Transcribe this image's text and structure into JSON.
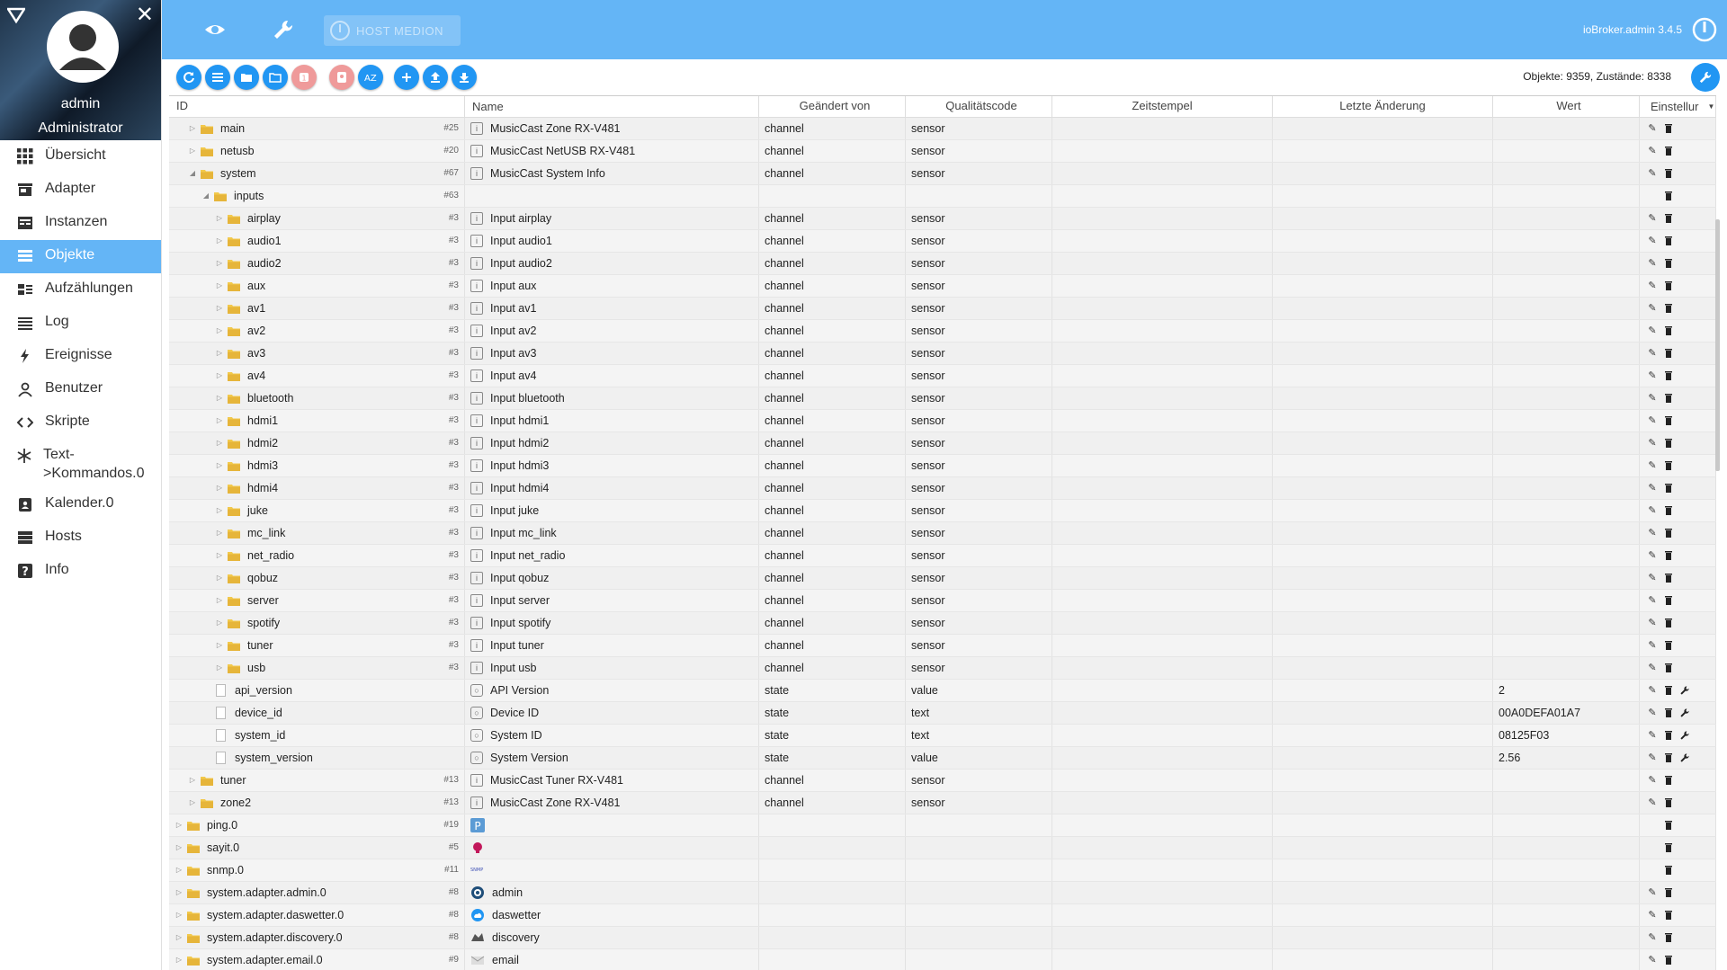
{
  "sidebar": {
    "user": "admin",
    "role": "Administrator",
    "items": [
      {
        "label": "Übersicht",
        "icon": "grid-icon"
      },
      {
        "label": "Adapter",
        "icon": "store-icon"
      },
      {
        "label": "Instanzen",
        "icon": "instances-icon"
      },
      {
        "label": "Objekte",
        "icon": "list-icon",
        "active": true
      },
      {
        "label": "Aufzählungen",
        "icon": "enum-icon"
      },
      {
        "label": "Log",
        "icon": "log-icon"
      },
      {
        "label": "Ereignisse",
        "icon": "bolt-icon"
      },
      {
        "label": "Benutzer",
        "icon": "user-icon"
      },
      {
        "label": "Skripte",
        "icon": "code-icon"
      },
      {
        "label": "Text->Kommandos.0",
        "icon": "snowflake-icon"
      },
      {
        "label": "Kalender.0",
        "icon": "calendar-icon"
      },
      {
        "label": "Hosts",
        "icon": "hosts-icon"
      },
      {
        "label": "Info",
        "icon": "help-icon"
      }
    ]
  },
  "topbar": {
    "host_label": "HOST MEDION",
    "version": "ioBroker.admin 3.4.5"
  },
  "toolbar": {
    "counts": "Objekte: 9359, Zustände: 8338"
  },
  "table": {
    "headers": {
      "id": "ID",
      "name": "Name",
      "changed_by": "Geändert von",
      "quality": "Qualitätscode",
      "timestamp": "Zeitstempel",
      "last_change": "Letzte Änderung",
      "value": "Wert",
      "settings": "Einstellur"
    },
    "rows": [
      {
        "id": "main",
        "indent": 1,
        "kind": "folder",
        "arrow": "▷",
        "count": "#25",
        "name": "MusicCast Zone RX-V481",
        "nicon": "i",
        "changed": "channel",
        "quality": "sensor",
        "value": "",
        "actions": "ed"
      },
      {
        "id": "netusb",
        "indent": 1,
        "kind": "folder",
        "arrow": "▷",
        "count": "#20",
        "name": "MusicCast NetUSB RX-V481",
        "nicon": "i",
        "changed": "channel",
        "quality": "sensor",
        "value": "",
        "actions": "ed"
      },
      {
        "id": "system",
        "indent": 1,
        "kind": "folder",
        "arrow": "◢",
        "count": "#67",
        "name": "MusicCast System Info",
        "nicon": "i",
        "changed": "channel",
        "quality": "sensor",
        "value": "",
        "actions": "ed"
      },
      {
        "id": "inputs",
        "indent": 2,
        "kind": "folder",
        "arrow": "◢",
        "count": "#63",
        "name": "",
        "nicon": "",
        "changed": "",
        "quality": "",
        "value": "",
        "actions": "d"
      },
      {
        "id": "airplay",
        "indent": 3,
        "kind": "folder",
        "arrow": "▷",
        "count": "#3",
        "name": "Input airplay",
        "nicon": "i",
        "changed": "channel",
        "quality": "sensor",
        "value": "",
        "actions": "ed"
      },
      {
        "id": "audio1",
        "indent": 3,
        "kind": "folder",
        "arrow": "▷",
        "count": "#3",
        "name": "Input audio1",
        "nicon": "i",
        "changed": "channel",
        "quality": "sensor",
        "value": "",
        "actions": "ed"
      },
      {
        "id": "audio2",
        "indent": 3,
        "kind": "folder",
        "arrow": "▷",
        "count": "#3",
        "name": "Input audio2",
        "nicon": "i",
        "changed": "channel",
        "quality": "sensor",
        "value": "",
        "actions": "ed"
      },
      {
        "id": "aux",
        "indent": 3,
        "kind": "folder",
        "arrow": "▷",
        "count": "#3",
        "name": "Input aux",
        "nicon": "i",
        "changed": "channel",
        "quality": "sensor",
        "value": "",
        "actions": "ed"
      },
      {
        "id": "av1",
        "indent": 3,
        "kind": "folder",
        "arrow": "▷",
        "count": "#3",
        "name": "Input av1",
        "nicon": "i",
        "changed": "channel",
        "quality": "sensor",
        "value": "",
        "actions": "ed"
      },
      {
        "id": "av2",
        "indent": 3,
        "kind": "folder",
        "arrow": "▷",
        "count": "#3",
        "name": "Input av2",
        "nicon": "i",
        "changed": "channel",
        "quality": "sensor",
        "value": "",
        "actions": "ed"
      },
      {
        "id": "av3",
        "indent": 3,
        "kind": "folder",
        "arrow": "▷",
        "count": "#3",
        "name": "Input av3",
        "nicon": "i",
        "changed": "channel",
        "quality": "sensor",
        "value": "",
        "actions": "ed"
      },
      {
        "id": "av4",
        "indent": 3,
        "kind": "folder",
        "arrow": "▷",
        "count": "#3",
        "name": "Input av4",
        "nicon": "i",
        "changed": "channel",
        "quality": "sensor",
        "value": "",
        "actions": "ed"
      },
      {
        "id": "bluetooth",
        "indent": 3,
        "kind": "folder",
        "arrow": "▷",
        "count": "#3",
        "name": "Input bluetooth",
        "nicon": "i",
        "changed": "channel",
        "quality": "sensor",
        "value": "",
        "actions": "ed"
      },
      {
        "id": "hdmi1",
        "indent": 3,
        "kind": "folder",
        "arrow": "▷",
        "count": "#3",
        "name": "Input hdmi1",
        "nicon": "i",
        "changed": "channel",
        "quality": "sensor",
        "value": "",
        "actions": "ed"
      },
      {
        "id": "hdmi2",
        "indent": 3,
        "kind": "folder",
        "arrow": "▷",
        "count": "#3",
        "name": "Input hdmi2",
        "nicon": "i",
        "changed": "channel",
        "quality": "sensor",
        "value": "",
        "actions": "ed"
      },
      {
        "id": "hdmi3",
        "indent": 3,
        "kind": "folder",
        "arrow": "▷",
        "count": "#3",
        "name": "Input hdmi3",
        "nicon": "i",
        "changed": "channel",
        "quality": "sensor",
        "value": "",
        "actions": "ed"
      },
      {
        "id": "hdmi4",
        "indent": 3,
        "kind": "folder",
        "arrow": "▷",
        "count": "#3",
        "name": "Input hdmi4",
        "nicon": "i",
        "changed": "channel",
        "quality": "sensor",
        "value": "",
        "actions": "ed"
      },
      {
        "id": "juke",
        "indent": 3,
        "kind": "folder",
        "arrow": "▷",
        "count": "#3",
        "name": "Input juke",
        "nicon": "i",
        "changed": "channel",
        "quality": "sensor",
        "value": "",
        "actions": "ed"
      },
      {
        "id": "mc_link",
        "indent": 3,
        "kind": "folder",
        "arrow": "▷",
        "count": "#3",
        "name": "Input mc_link",
        "nicon": "i",
        "changed": "channel",
        "quality": "sensor",
        "value": "",
        "actions": "ed"
      },
      {
        "id": "net_radio",
        "indent": 3,
        "kind": "folder",
        "arrow": "▷",
        "count": "#3",
        "name": "Input net_radio",
        "nicon": "i",
        "changed": "channel",
        "quality": "sensor",
        "value": "",
        "actions": "ed"
      },
      {
        "id": "qobuz",
        "indent": 3,
        "kind": "folder",
        "arrow": "▷",
        "count": "#3",
        "name": "Input qobuz",
        "nicon": "i",
        "changed": "channel",
        "quality": "sensor",
        "value": "",
        "actions": "ed"
      },
      {
        "id": "server",
        "indent": 3,
        "kind": "folder",
        "arrow": "▷",
        "count": "#3",
        "name": "Input server",
        "nicon": "i",
        "changed": "channel",
        "quality": "sensor",
        "value": "",
        "actions": "ed"
      },
      {
        "id": "spotify",
        "indent": 3,
        "kind": "folder",
        "arrow": "▷",
        "count": "#3",
        "name": "Input spotify",
        "nicon": "i",
        "changed": "channel",
        "quality": "sensor",
        "value": "",
        "actions": "ed"
      },
      {
        "id": "tuner",
        "indent": 3,
        "kind": "folder",
        "arrow": "▷",
        "count": "#3",
        "name": "Input tuner",
        "nicon": "i",
        "changed": "channel",
        "quality": "sensor",
        "value": "",
        "actions": "ed"
      },
      {
        "id": "usb",
        "indent": 3,
        "kind": "folder",
        "arrow": "▷",
        "count": "#3",
        "name": "Input usb",
        "nicon": "i",
        "changed": "channel",
        "quality": "sensor",
        "value": "",
        "actions": "ed"
      },
      {
        "id": "api_version",
        "indent": 2,
        "kind": "file",
        "arrow": "",
        "count": "",
        "name": "API Version",
        "nicon": "s",
        "changed": "state",
        "quality": "value",
        "value": "2",
        "actions": "edw"
      },
      {
        "id": "device_id",
        "indent": 2,
        "kind": "file",
        "arrow": "",
        "count": "",
        "name": "Device ID",
        "nicon": "s",
        "changed": "state",
        "quality": "text",
        "value": "00A0DEFA01A7",
        "actions": "edw"
      },
      {
        "id": "system_id",
        "indent": 2,
        "kind": "file",
        "arrow": "",
        "count": "",
        "name": "System ID",
        "nicon": "s",
        "changed": "state",
        "quality": "text",
        "value": "08125F03",
        "actions": "edw"
      },
      {
        "id": "system_version",
        "indent": 2,
        "kind": "file",
        "arrow": "",
        "count": "",
        "name": "System Version",
        "nicon": "s",
        "changed": "state",
        "quality": "value",
        "value": "2.56",
        "actions": "edw"
      },
      {
        "id": "tuner",
        "indent": 1,
        "kind": "folder",
        "arrow": "▷",
        "count": "#13",
        "name": "MusicCast Tuner RX-V481",
        "nicon": "i",
        "changed": "channel",
        "quality": "sensor",
        "value": "",
        "actions": "ed"
      },
      {
        "id": "zone2",
        "indent": 1,
        "kind": "folder",
        "arrow": "▷",
        "count": "#13",
        "name": "MusicCast Zone RX-V481",
        "nicon": "i",
        "changed": "channel",
        "quality": "sensor",
        "value": "",
        "actions": "ed"
      },
      {
        "id": "ping.0",
        "indent": 0,
        "kind": "folder",
        "arrow": "▷",
        "count": "#19",
        "name": "",
        "nicon": "ping",
        "changed": "",
        "quality": "",
        "value": "",
        "actions": "d"
      },
      {
        "id": "sayit.0",
        "indent": 0,
        "kind": "folder",
        "arrow": "▷",
        "count": "#5",
        "name": "",
        "nicon": "sayit",
        "changed": "",
        "quality": "",
        "value": "",
        "actions": "d"
      },
      {
        "id": "snmp.0",
        "indent": 0,
        "kind": "folder",
        "arrow": "▷",
        "count": "#11",
        "name": "",
        "nicon": "snmp",
        "changed": "",
        "quality": "",
        "value": "",
        "actions": "d"
      },
      {
        "id": "system.adapter.admin.0",
        "indent": 0,
        "kind": "folder",
        "arrow": "▷",
        "count": "#8",
        "name": "admin",
        "nicon": "admin",
        "changed": "",
        "quality": "",
        "value": "",
        "actions": "ed"
      },
      {
        "id": "system.adapter.daswetter.0",
        "indent": 0,
        "kind": "folder",
        "arrow": "▷",
        "count": "#8",
        "name": "daswetter",
        "nicon": "daswetter",
        "changed": "",
        "quality": "",
        "value": "",
        "actions": "ed"
      },
      {
        "id": "system.adapter.discovery.0",
        "indent": 0,
        "kind": "folder",
        "arrow": "▷",
        "count": "#8",
        "name": "discovery",
        "nicon": "discovery",
        "changed": "",
        "quality": "",
        "value": "",
        "actions": "ed"
      },
      {
        "id": "system.adapter.email.0",
        "indent": 0,
        "kind": "folder",
        "arrow": "▷",
        "count": "#9",
        "name": "email",
        "nicon": "email",
        "changed": "",
        "quality": "",
        "value": "",
        "actions": "ed"
      }
    ]
  },
  "colors": {
    "accent": "#64b5f6",
    "button": "#2196f3",
    "folder": "#f2c94c"
  }
}
